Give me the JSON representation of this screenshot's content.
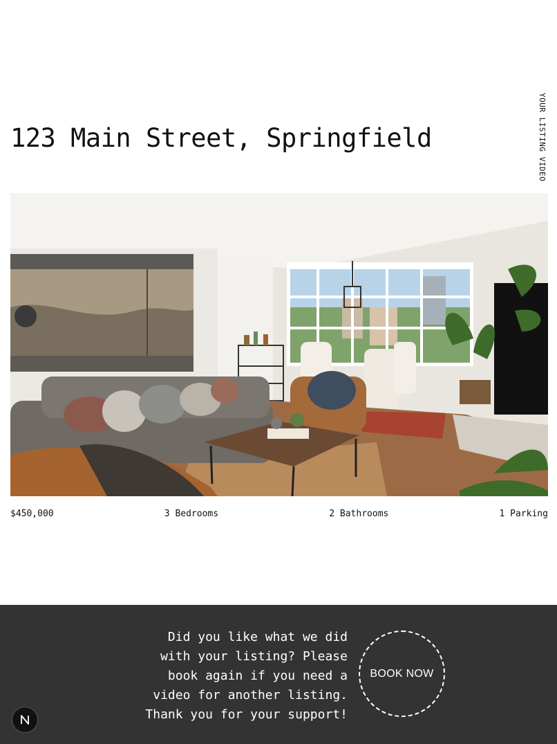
{
  "side_label": "YOUR LISTING VIDEO",
  "listing": {
    "address": "123 Main Street, Springfield",
    "photo_icon": "living-room-photo",
    "stats": {
      "price": "$450,000",
      "bedrooms": "3 Bedrooms",
      "bathrooms": "2 Bathrooms",
      "parking": "1 Parking"
    }
  },
  "footer": {
    "message": "Did you like what we did\nwith your listing? Please\nbook again if you need a\nvideo for another listing.\nThank you for your support!",
    "book_button": "BOOK NOW",
    "badge_icon": "next-logo-icon"
  },
  "colors": {
    "background": "#ffffff",
    "footer_background": "#333333",
    "text": "#111111",
    "footer_text": "#ffffff"
  }
}
